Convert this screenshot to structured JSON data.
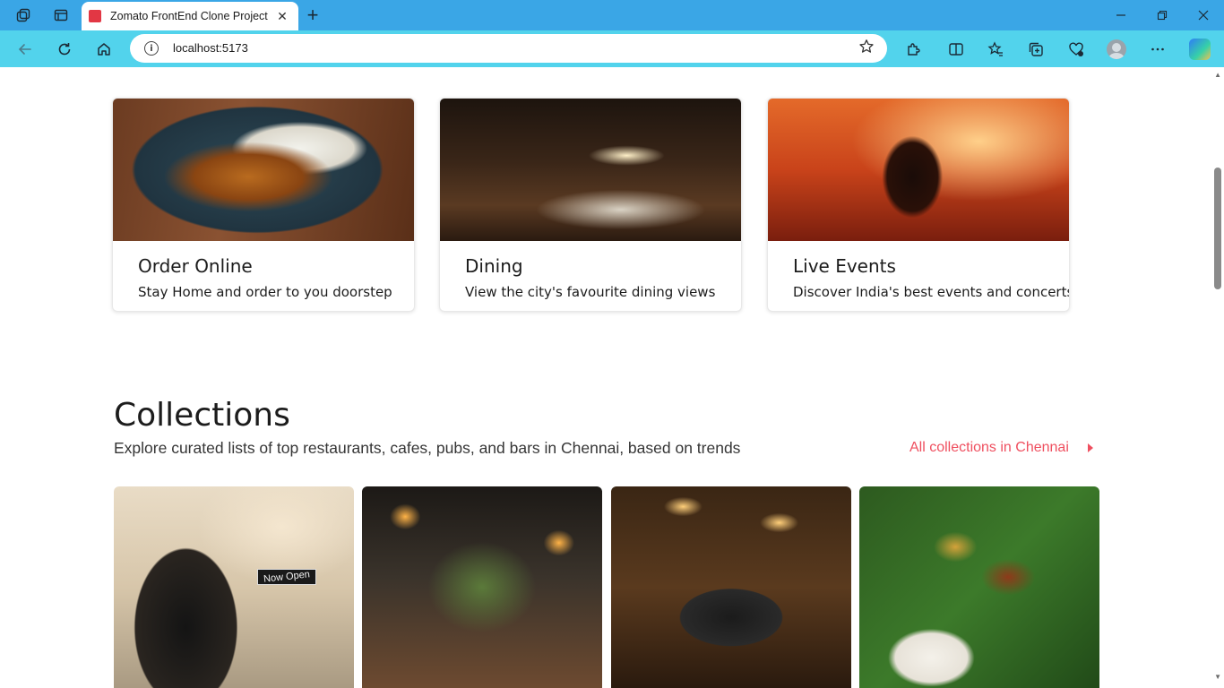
{
  "browser": {
    "tab_title": "Zomato FrontEnd Clone Project",
    "url": "localhost:5173",
    "tab_close_glyph": "✕",
    "new_tab_glyph": "+",
    "icons": [
      "workspaces-icon",
      "tab-actions-icon",
      "back-icon",
      "refresh-icon",
      "home-icon",
      "info-icon",
      "favorite-star-icon",
      "extensions-icon",
      "split-screen-icon",
      "favorites-icon",
      "collections-icon",
      "performance-icon",
      "profile-avatar-icon",
      "more-icon",
      "copilot-icon",
      "minimize-icon",
      "maximize-icon",
      "close-icon"
    ]
  },
  "cards": [
    {
      "title": "Order Online",
      "subtitle": "Stay Home and order to you doorstep",
      "image": "food-plate"
    },
    {
      "title": "Dining",
      "subtitle": "View the city's favourite dining views",
      "image": "restaurant-interior"
    },
    {
      "title": "Live Events",
      "subtitle": "Discover India's best events and concerts",
      "image": "concert"
    }
  ],
  "collections": {
    "title": "Collections",
    "subtitle": "Explore curated lists of top restaurants, cafes, pubs, and bars in Chennai, based on trends",
    "link_label": "All collections in Chennai",
    "items": [
      {
        "image": "now-open-storefront",
        "sign_text": "Now Open"
      },
      {
        "image": "lantern-restaurant"
      },
      {
        "image": "phone-photo-restaurant"
      },
      {
        "image": "banana-leaf-meal"
      }
    ]
  },
  "colors": {
    "titlebar": "#3aa6e6",
    "toolbar": "#52d3ec",
    "accent_link": "#ef4f5f"
  }
}
